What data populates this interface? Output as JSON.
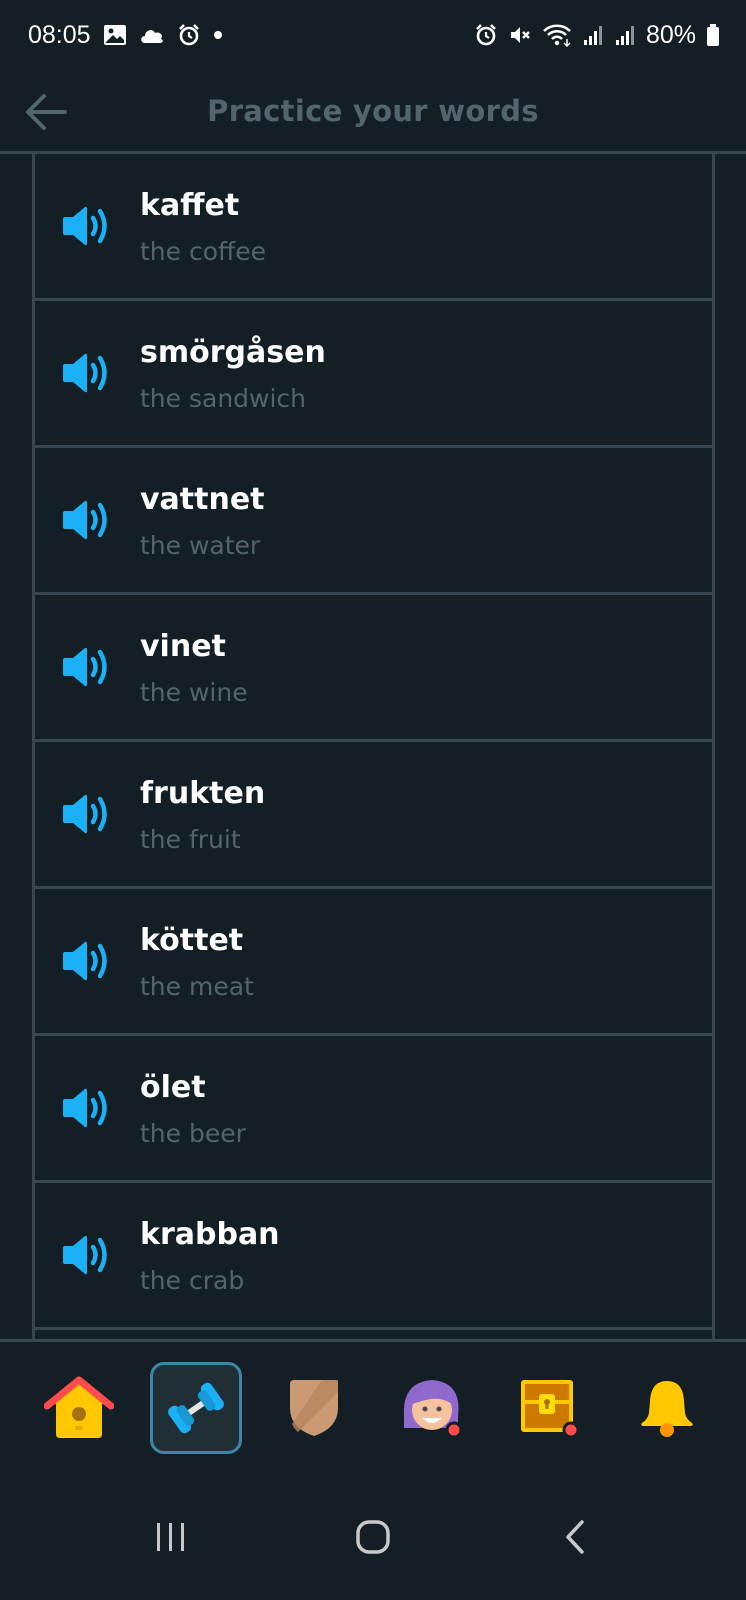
{
  "status_bar": {
    "time": "08:05",
    "battery": "80%"
  },
  "header": {
    "title": "Practice your words"
  },
  "words": [
    {
      "word": "kaffet",
      "translation": "the coffee"
    },
    {
      "word": "smörgåsen",
      "translation": "the sandwich"
    },
    {
      "word": "vattnet",
      "translation": "the water"
    },
    {
      "word": "vinet",
      "translation": "the wine"
    },
    {
      "word": "frukten",
      "translation": "the fruit"
    },
    {
      "word": "köttet",
      "translation": "the meat"
    },
    {
      "word": "ölet",
      "translation": "the beer"
    },
    {
      "word": "krabban",
      "translation": "the crab"
    }
  ],
  "bottom_nav": [
    {
      "name": "home-icon",
      "active": false
    },
    {
      "name": "dumbbell-icon",
      "active": true
    },
    {
      "name": "shield-icon",
      "active": false
    },
    {
      "name": "character-avatar-icon",
      "active": false
    },
    {
      "name": "treasure-chest-icon",
      "active": false
    },
    {
      "name": "bell-icon",
      "active": false
    }
  ],
  "colors": {
    "background": "#131f24",
    "border": "#37464f",
    "muted_text": "#52656d",
    "speaker_blue": "#1cb0f6",
    "active_tab_border": "#3f86a6"
  }
}
